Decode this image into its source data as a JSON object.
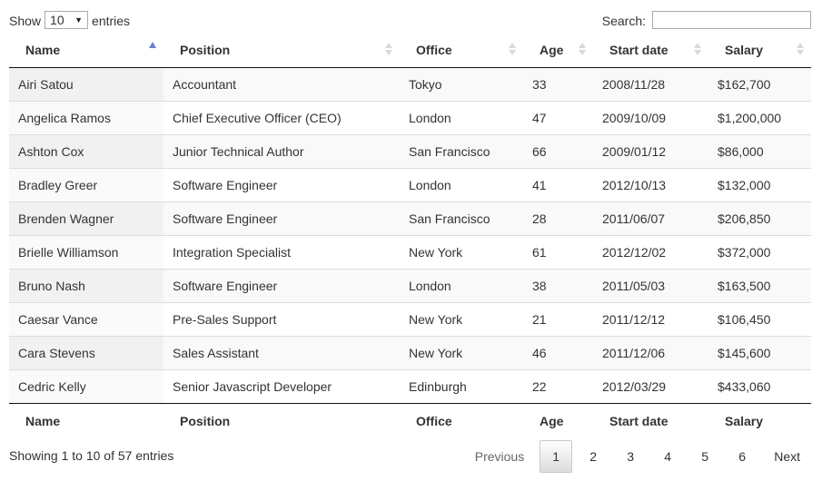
{
  "length": {
    "show_label": "Show",
    "selected": "10",
    "entries_label": "entries"
  },
  "search": {
    "label": "Search:",
    "value": ""
  },
  "table": {
    "columns": [
      {
        "label": "Name",
        "sort": "asc"
      },
      {
        "label": "Position",
        "sort": "none"
      },
      {
        "label": "Office",
        "sort": "none"
      },
      {
        "label": "Age",
        "sort": "none"
      },
      {
        "label": "Start date",
        "sort": "none"
      },
      {
        "label": "Salary",
        "sort": "none"
      }
    ],
    "rows": [
      [
        "Airi Satou",
        "Accountant",
        "Tokyo",
        "33",
        "2008/11/28",
        "$162,700"
      ],
      [
        "Angelica Ramos",
        "Chief Executive Officer (CEO)",
        "London",
        "47",
        "2009/10/09",
        "$1,200,000"
      ],
      [
        "Ashton Cox",
        "Junior Technical Author",
        "San Francisco",
        "66",
        "2009/01/12",
        "$86,000"
      ],
      [
        "Bradley Greer",
        "Software Engineer",
        "London",
        "41",
        "2012/10/13",
        "$132,000"
      ],
      [
        "Brenden Wagner",
        "Software Engineer",
        "San Francisco",
        "28",
        "2011/06/07",
        "$206,850"
      ],
      [
        "Brielle Williamson",
        "Integration Specialist",
        "New York",
        "61",
        "2012/12/02",
        "$372,000"
      ],
      [
        "Bruno Nash",
        "Software Engineer",
        "London",
        "38",
        "2011/05/03",
        "$163,500"
      ],
      [
        "Caesar Vance",
        "Pre-Sales Support",
        "New York",
        "21",
        "2011/12/12",
        "$106,450"
      ],
      [
        "Cara Stevens",
        "Sales Assistant",
        "New York",
        "46",
        "2011/12/06",
        "$145,600"
      ],
      [
        "Cedric Kelly",
        "Senior Javascript Developer",
        "Edinburgh",
        "22",
        "2012/03/29",
        "$433,060"
      ]
    ],
    "footer": [
      "Name",
      "Position",
      "Office",
      "Age",
      "Start date",
      "Salary"
    ]
  },
  "info": "Showing 1 to 10 of 57 entries",
  "pagination": {
    "previous": "Previous",
    "pages": [
      "1",
      "2",
      "3",
      "4",
      "5",
      "6"
    ],
    "current": "1",
    "next": "Next"
  },
  "colors": {
    "sort_active": "#6a7fd3",
    "sort_inactive": "#d9d9d9",
    "border": "#111111"
  }
}
